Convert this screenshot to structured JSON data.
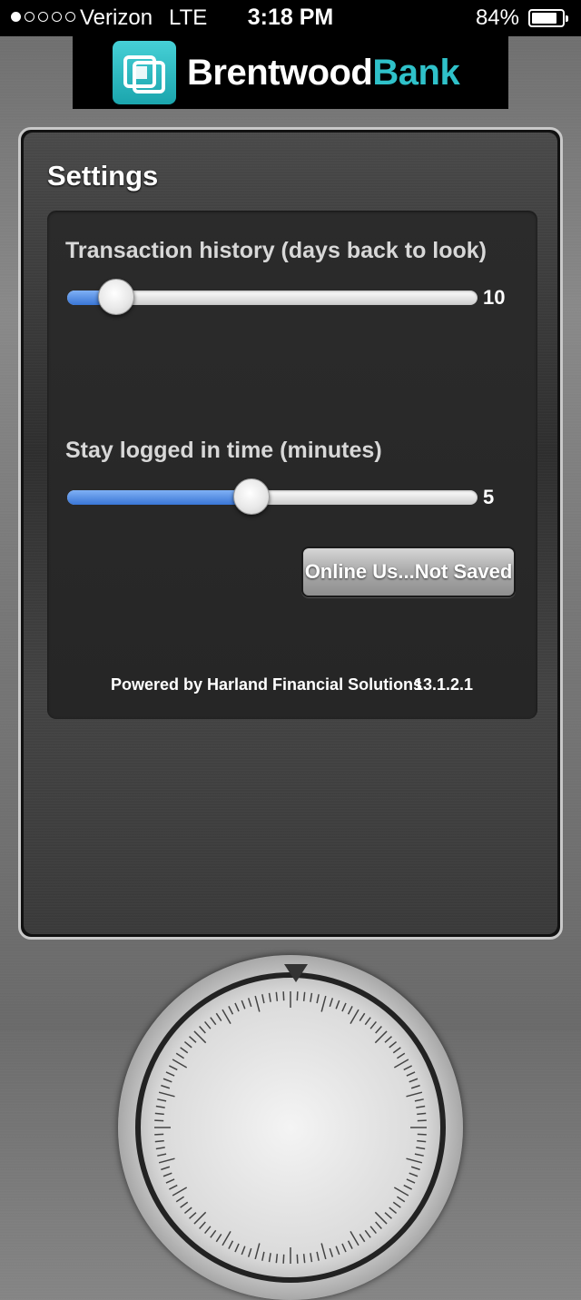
{
  "status_bar": {
    "carrier": "Verizon",
    "network": "LTE",
    "time": "3:18 PM",
    "battery": "84%",
    "battery_level": 0.84
  },
  "header": {
    "brand_first": "Brentwood",
    "brand_second": "Bank",
    "logo_icon": "bank-logo-icon"
  },
  "settings": {
    "title": "Settings",
    "transaction_history": {
      "label": "Transaction history (days back to look)",
      "value": "10",
      "level": 0.12
    },
    "stay_logged_in": {
      "label": "Stay logged in time (minutes)",
      "value": "5",
      "level": 0.45
    },
    "save_button_label": "Online Us...Not Saved",
    "powered_by": "Powered by Harland Financial Solutions",
    "version": "13.1.2.1"
  },
  "colors": {
    "slider_fill": "#3a76d6",
    "brand_teal": "#2fc1c9"
  }
}
